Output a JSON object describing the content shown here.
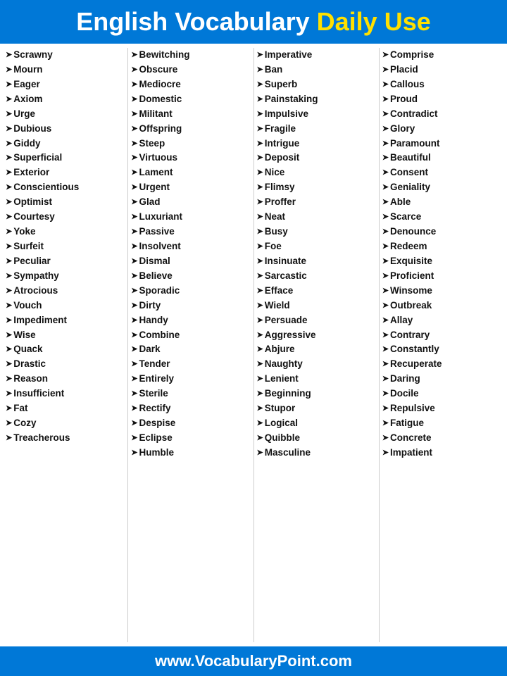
{
  "header": {
    "title_white": "English Vocabulary",
    "title_yellow": "Daily Use"
  },
  "columns": [
    {
      "words": [
        "Scrawny",
        "Mourn",
        "Eager",
        "Axiom",
        "Urge",
        "Dubious",
        "Giddy",
        "Superficial",
        "Exterior",
        "Conscientious",
        "Optimist",
        "Courtesy",
        "Yoke",
        "Surfeit",
        "Peculiar",
        "Sympathy",
        "Atrocious",
        "Vouch",
        "Impediment",
        "Wise",
        "Quack",
        "Drastic",
        "Reason",
        "Insufficient",
        "Fat",
        "Cozy",
        "Treacherous"
      ]
    },
    {
      "words": [
        "Bewitching",
        "Obscure",
        "Mediocre",
        "Domestic",
        "Militant",
        "Offspring",
        "Steep",
        "Virtuous",
        "Lament",
        "Urgent",
        "Glad",
        "Luxuriant",
        "Passive",
        "Insolvent",
        "Dismal",
        "Believe",
        "Sporadic",
        "Dirty",
        "Handy",
        "Combine",
        "Dark",
        "Tender",
        "Entirely",
        "Sterile",
        "Rectify",
        "Despise",
        "Eclipse",
        "Humble"
      ]
    },
    {
      "words": [
        "Imperative",
        "Ban",
        "Superb",
        "Painstaking",
        "Impulsive",
        "Fragile",
        "Intrigue",
        "Deposit",
        "Nice",
        "Flimsy",
        "Proffer",
        "Neat",
        "Busy",
        "Foe",
        "Insinuate",
        "Sarcastic",
        "Efface",
        "Wield",
        "Persuade",
        "Aggressive",
        "Abjure",
        "Naughty",
        "Lenient",
        "Beginning",
        "Stupor",
        "Logical",
        "Quibble",
        "Masculine"
      ]
    },
    {
      "words": [
        "Comprise",
        "Placid",
        "Callous",
        "Proud",
        "Contradict",
        "Glory",
        "Paramount",
        "Beautiful",
        "Consent",
        "Geniality",
        "Able",
        "Scarce",
        "Denounce",
        "Redeem",
        "Exquisite",
        "Proficient",
        "Winsome",
        "Outbreak",
        "Allay",
        "Contrary",
        "Constantly",
        "Recuperate",
        "Daring",
        "Docile",
        "Repulsive",
        "Fatigue",
        "Concrete",
        "Impatient"
      ]
    }
  ],
  "footer": {
    "url": "www.VocabularyPoint.com"
  }
}
